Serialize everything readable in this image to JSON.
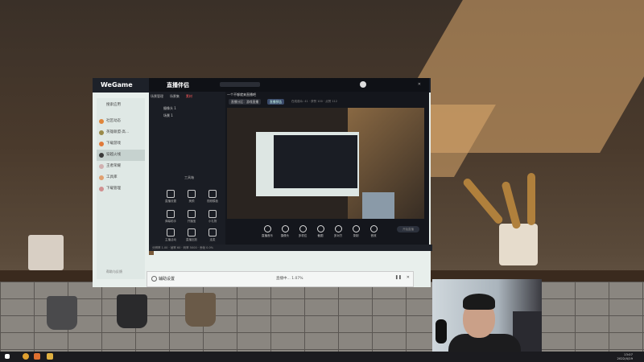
{
  "wegame": {
    "logo": "WeGame",
    "search_placeholder": "搜索应用",
    "sidebar": [
      {
        "label": "社区动态",
        "color": "#e0853a"
      },
      {
        "label": "英雄联盟·高...",
        "color": "#9a8a4a"
      },
      {
        "label": "下载游戏",
        "color": "#e07a3a"
      },
      {
        "label": "穿越火线",
        "color": "#3a3a3a"
      },
      {
        "label": "王者荣耀",
        "color": "#d0b0b0"
      },
      {
        "label": "工具库",
        "color": "#e0a070"
      },
      {
        "label": "下载管理",
        "color": "#d09090"
      }
    ],
    "bottom_link": "帮助与反馈"
  },
  "stream": {
    "app_name": "直播伴侣",
    "tabs": [
      "场景管理",
      "场景集",
      "素材"
    ],
    "active_tab": 2,
    "scenes": [
      "摄像头 1",
      "场景 1"
    ],
    "title_text": "一个不够就来直播吧",
    "topbar": {
      "title_btn": "标题",
      "pill1": "直播分区：游戏直播",
      "pill2": "直播预告",
      "stats": "在线观众: 41 · 获赞 100 · 点赞 112"
    },
    "tools_title": "工具箱",
    "tools": [
      "直播设置",
      "美颜",
      "视频模板",
      "弹幕助手",
      "开播宝",
      "小礼物",
      "主播活动",
      "直播回放",
      "连麦"
    ],
    "bottom_buttons": [
      "直播音乐",
      "摄像头",
      "多机位",
      "截图",
      "多对方",
      "录制",
      "音效"
    ],
    "go_live": "开始直播",
    "status": "分辨率 1.00 · 帧率 60 · 码率 5000 · 丢帧 0.0%"
  },
  "live_bar": {
    "label": "辅助设置",
    "progress": "直播中... 1.07%"
  },
  "taskbar": {
    "time": "13:07",
    "date": "2022/4/19"
  }
}
